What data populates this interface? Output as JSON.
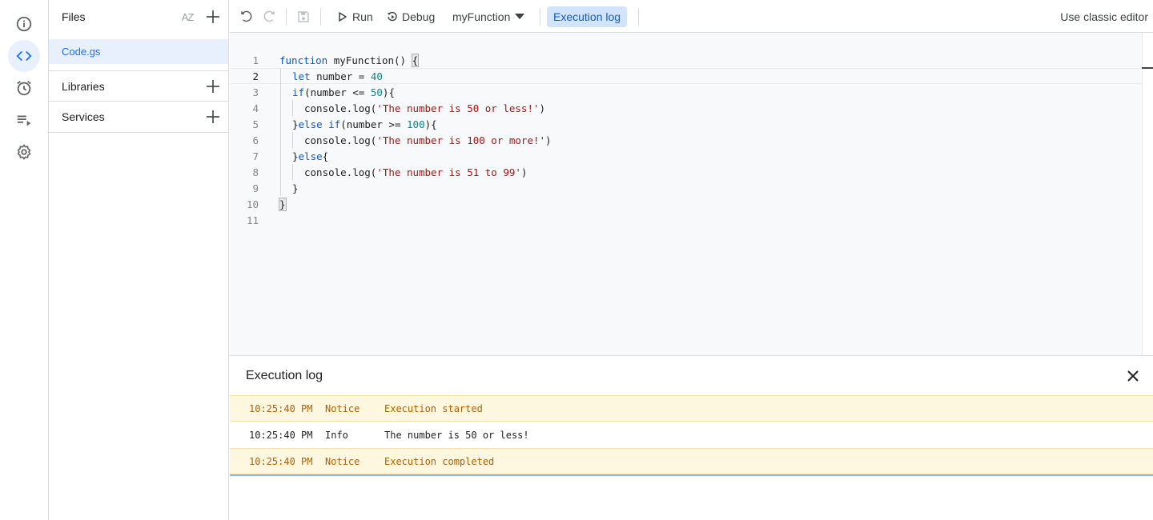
{
  "rail": {
    "items": [
      {
        "name": "overview",
        "icon": "info-icon",
        "active": false
      },
      {
        "name": "editor",
        "icon": "code-icon",
        "active": true
      },
      {
        "name": "triggers",
        "icon": "alarm-clock-icon",
        "active": false
      },
      {
        "name": "executions",
        "icon": "playlist-play-icon",
        "active": false
      },
      {
        "name": "project-settings",
        "icon": "gear-icon",
        "active": false
      }
    ]
  },
  "files_panel": {
    "title": "Files",
    "sort_icon": "AZ",
    "files": [
      {
        "name": "Code.gs",
        "selected": true
      }
    ],
    "sections": [
      {
        "label": "Libraries"
      },
      {
        "label": "Services"
      }
    ]
  },
  "toolbar": {
    "run_label": "Run",
    "debug_label": "Debug",
    "function_selected": "myFunction",
    "execution_log_label": "Execution log",
    "classic_editor_label": "Use classic editor"
  },
  "editor": {
    "current_line": 2,
    "lines": [
      {
        "n": "1"
      },
      {
        "n": "2"
      },
      {
        "n": "3"
      },
      {
        "n": "4"
      },
      {
        "n": "5"
      },
      {
        "n": "6"
      },
      {
        "n": "7"
      },
      {
        "n": "8"
      },
      {
        "n": "9"
      },
      {
        "n": "10"
      },
      {
        "n": "11"
      }
    ],
    "tokens": {
      "l1_kw": "function",
      "l1_rest": " myFunction() ",
      "l1_brace": "{",
      "l2_kw": "let",
      "l2_rest": " number = ",
      "l2_num": "40",
      "l3_kw": "if",
      "l3_rest": "(number <= ",
      "l3_num": "50",
      "l3_end": "){",
      "l4_pre": "console.log(",
      "l4_str": "'The number is 50 or less!'",
      "l4_end": ")",
      "l5_pre": "}",
      "l5_kw": "else if",
      "l5_rest": "(number >= ",
      "l5_num": "100",
      "l5_end": "){",
      "l6_pre": "console.log(",
      "l6_str": "'The number is 100 or more!'",
      "l6_end": ")",
      "l7_pre": "}",
      "l7_kw": "else",
      "l7_end": "{",
      "l8_pre": "console.log(",
      "l8_str": "'The number is 51 to 99'",
      "l8_end": ")",
      "l9": "}",
      "l10": "}"
    }
  },
  "execution_log": {
    "title": "Execution log",
    "rows": [
      {
        "time": "10:25:40 PM",
        "level": "Notice",
        "message": "Execution started"
      },
      {
        "time": "10:25:40 PM",
        "level": "Info",
        "message": "The number is 50 or less!"
      },
      {
        "time": "10:25:40 PM",
        "level": "Notice",
        "message": "Execution completed"
      }
    ]
  },
  "colors": {
    "accent": "#1a73e8",
    "active_bg": "#e8f0fe",
    "notice_bg": "#fef7e0",
    "notice_text": "#b06000",
    "keyword": "#0b57d0",
    "number": "#098591",
    "string": "#a31515"
  }
}
